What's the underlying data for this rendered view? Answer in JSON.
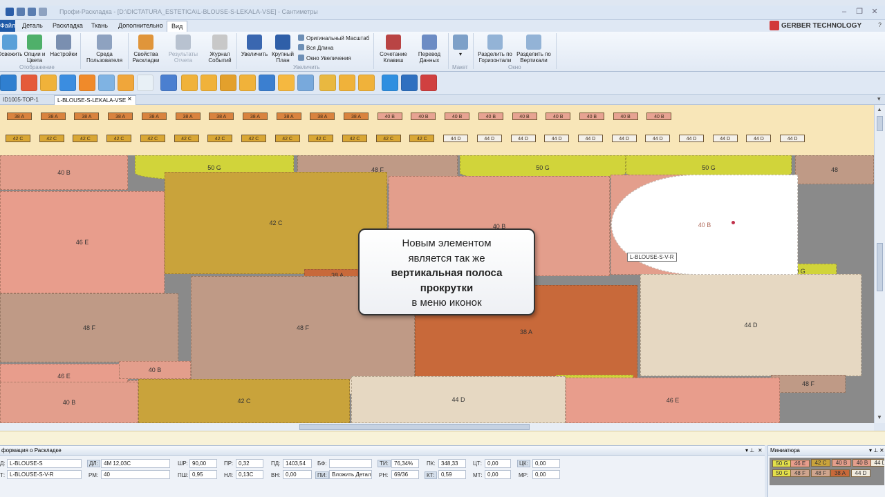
{
  "app": {
    "title": "Профи-Раскладка - [D:\\DICTATURA_ESTETICA\\L-BLOUSE-S-LEKALA-VSE] - Сантиметры",
    "brand": "GERBER TECHNOLOGY"
  },
  "menu": {
    "file": "Файл",
    "tabs": [
      "Деталь",
      "Раскладка",
      "Ткань",
      "Дополнительно",
      "Вид"
    ],
    "active": "Вид"
  },
  "ribbon": {
    "buttons": [
      {
        "label": "Освежить",
        "color": "#5aa0d8"
      },
      {
        "label": "Опции и\nЦвета",
        "color": "#4fb06a"
      },
      {
        "label": "Настройки",
        "color": "#7a8fb0"
      },
      {
        "label": "Среда\nПользователя",
        "color": "#8ea2c0"
      },
      {
        "label": "Свойства\nРаскладки",
        "color": "#e0953a"
      },
      {
        "label": "Результаты\nОтчета",
        "color": "#b8c2d0"
      },
      {
        "label": "Журнал\nСобытий",
        "color": "#c8c8c8"
      },
      {
        "label": "Увеличить",
        "color": "#3a67b0"
      },
      {
        "label": "Крупный\nПлан",
        "color": "#2f5fa8"
      },
      {
        "label": "Сочетание\nКлавиш",
        "color": "#b94444"
      },
      {
        "label": "Перевод\nДанных",
        "color": "#6c8cc4"
      },
      {
        "label": "",
        "color": "#7da0c8"
      },
      {
        "label": "Разделить по\nГоризонтали",
        "color": "#93b3d6"
      },
      {
        "label": "Разделить по\nВертикали",
        "color": "#93b3d6"
      }
    ],
    "small": [
      "Оригинальный Масштаб",
      "Вся Длина",
      "Окно Увеличения"
    ],
    "groups": [
      "Отображение",
      "Увеличить",
      "Макет",
      "Окно"
    ]
  },
  "toolbar_colors": [
    "#2f7fd0",
    "#e55a3a",
    "#f0b23a",
    "#3b8de0",
    "#f08a2a",
    "#7fb3e3",
    "#f0a63a",
    "#e8f0f6",
    "#4a7fd0",
    "#f0b23a",
    "#f0b23a",
    "#e3a02c",
    "#f0b23a",
    "#3b7fd0",
    "#f5b840",
    "#78a9dc",
    "#e9b840",
    "#f0b23a",
    "#f0b23a",
    "#2f8fe0",
    "#2f70c0",
    "#d04040"
  ],
  "doctabs": [
    "ID1005-TOP-1",
    "L-BLOUSE-S-LEKALA-VSE"
  ],
  "strip": {
    "row1": [
      "38 A",
      "38 A",
      "38 A",
      "38 A",
      "38 A",
      "38 A",
      "38 A",
      "38 A",
      "38 A",
      "38 A",
      "38 A",
      "40 B",
      "40 B",
      "40 B",
      "40 B",
      "40 B",
      "40 B",
      "40 B",
      "40 B",
      "40 B"
    ],
    "row2": [
      "42 C",
      "42 C",
      "42 C",
      "42 C",
      "42 C",
      "42 C",
      "42 C",
      "42 C",
      "42 C",
      "42 C",
      "42 C",
      "42 C",
      "42 C",
      "44 D",
      "44 D",
      "44 D",
      "44 D",
      "44 D",
      "44 D",
      "44 D",
      "44 D",
      "44 D",
      "44 D",
      "44 D"
    ]
  },
  "pieces": [
    "40 B",
    "50 G",
    "48 F",
    "50 G",
    "50 G",
    "48",
    "46 E",
    "42 C",
    "40 B",
    "40 B",
    "38 A",
    "50 G",
    "48 F",
    "38 A",
    "44 D",
    "48 F",
    "46 E",
    "40 B",
    "40 B",
    "44 D",
    "50 G",
    "48 F",
    "40 B",
    "42 C",
    "44 D",
    "46 E"
  ],
  "callout": {
    "l1": "Новым элементом",
    "l2": "является так же",
    "l3": "вертикальная полоса",
    "l4": "прокрутки",
    "l5": "в меню иконок"
  },
  "tooltip": "L-BLOUSE-S-V-R",
  "info": {
    "title": "формация о Раскладке",
    "f": {
      "d_lbl": "Д:",
      "d": "L-BLOUSE-S",
      "t_lbl": "Т:",
      "t": "L-BLOUSE-S-V-R",
      "dl_lbl": "ДЛ:",
      "dl": "4M 12,03C",
      "rm_lbl": "РМ:",
      "rm": "40",
      "shr_lbl": "ШР:",
      "shr": "90,00",
      "psh_lbl": "ПШ:",
      "psh": "0,95",
      "pr_lbl": "ПР:",
      "pr": "0,32",
      "nl_lbl": "НЛ:",
      "nl": "0,13C",
      "pd_lbl": "ПД:",
      "pd": "1403,54",
      "vn_lbl": "ВН:",
      "vn": "0,00",
      "bf_lbl": "БФ:",
      "bf": "",
      "pi_lbl": "ПИ:",
      "pi": "Вложить Детали",
      "ti_lbl": "ТИ:",
      "ti": "76,34%",
      "rn_lbl": "РН:",
      "rn": "69/36",
      "pk_lbl": "ПК:",
      "pk": "348,33",
      "kt_lbl": "КТ:",
      "kt": "0,59",
      "ct_lbl": "ЦТ:",
      "ct": "0,00",
      "mt_lbl": "МТ:",
      "mt": "0,00",
      "ck_lbl": "ЦК:",
      "ck": "0,00",
      "mr_lbl": "МР:",
      "mr": "0,00"
    }
  },
  "mini": {
    "title": "Миниатюра",
    "items": [
      "50 G",
      "46 E",
      "42 C",
      "40 B",
      "40 B",
      "44 D",
      "50 G",
      "48 F",
      "48 F",
      "38 A",
      "44 D"
    ]
  }
}
